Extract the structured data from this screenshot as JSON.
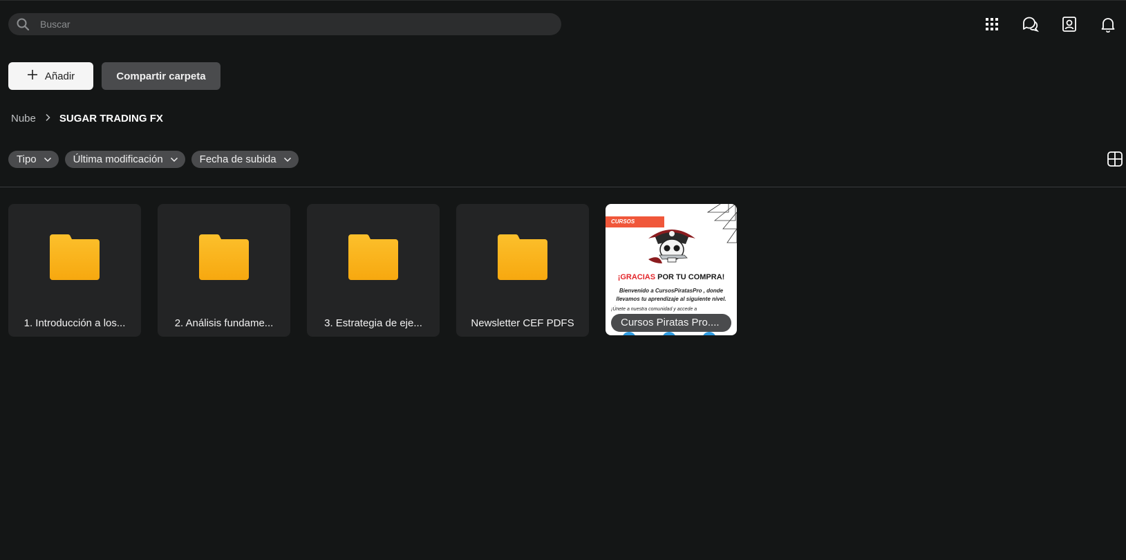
{
  "search": {
    "placeholder": "Buscar"
  },
  "top_icons": [
    "apps-grid-icon",
    "chat-icon",
    "contact-icon",
    "bell-icon"
  ],
  "actions": {
    "add_label": "Añadir",
    "share_label": "Compartir carpeta"
  },
  "breadcrumb": {
    "root": "Nube",
    "current": "SUGAR TRADING FX"
  },
  "filters": [
    {
      "label": "Tipo"
    },
    {
      "label": "Última modificación"
    },
    {
      "label": "Fecha de subida"
    }
  ],
  "items": [
    {
      "name": "1. Introducción a los...",
      "type": "folder"
    },
    {
      "name": "2. Análisis fundame...",
      "type": "folder"
    },
    {
      "name": "3. Estrategia de eje...",
      "type": "folder"
    },
    {
      "name": "Newsletter CEF PDFS",
      "type": "folder"
    },
    {
      "name": "Cursos Piratas Pro....",
      "type": "image"
    }
  ],
  "thumbnail": {
    "ribbon": "CURSOS ACTUALIZADOS",
    "headline_red": "¡GRACIAS",
    "headline_rest": " POR TU COMPRA!",
    "sub_line1": "Bienvenido a CursosPiratasPro , donde",
    "sub_line2": "llevamos tu aprendizaje al siguiente nivel.",
    "sub_line3": "¡Únete a nuestra comunidad y accede a"
  },
  "colors": {
    "background": "#141616",
    "folder": "#fbb117",
    "chip": "#4a4b4d",
    "accent_red": "#e3262b"
  }
}
